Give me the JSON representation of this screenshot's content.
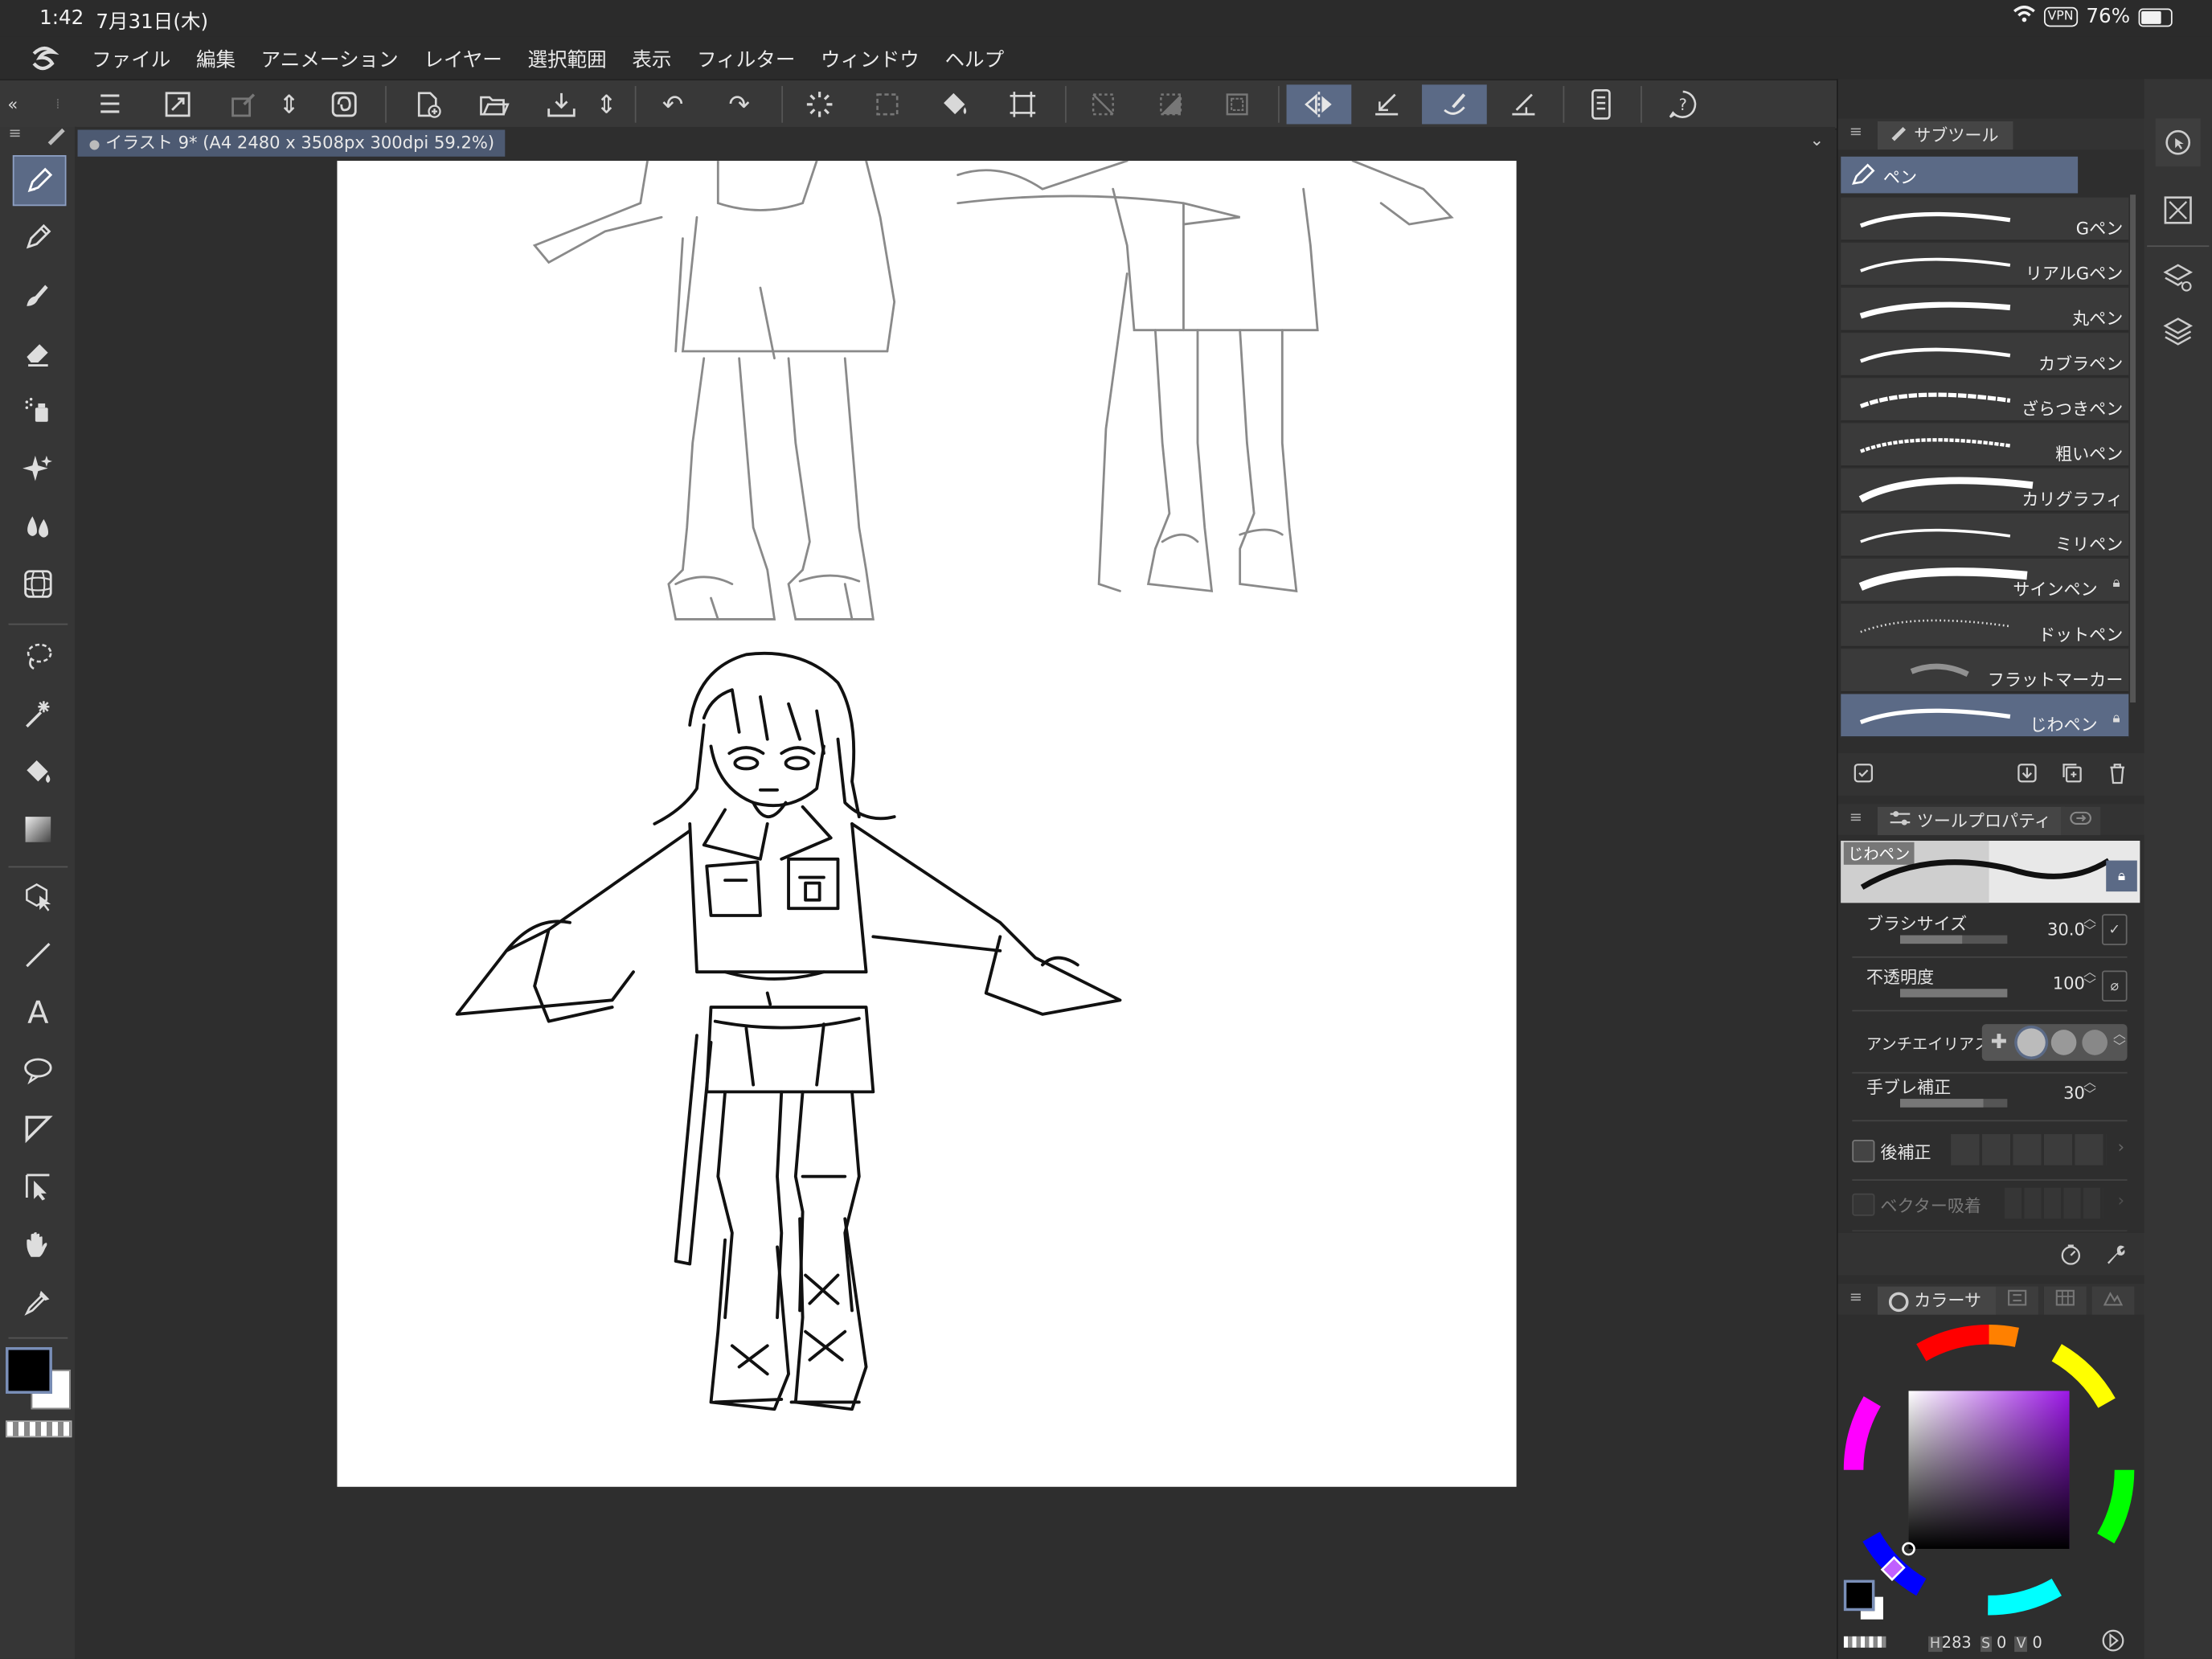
{
  "status": {
    "time": "1:42",
    "date": "7月31日(木)",
    "vpn": "VPN",
    "battery": "76%"
  },
  "menu": [
    "ファイル",
    "編集",
    "アニメーション",
    "レイヤー",
    "選択範囲",
    "表示",
    "フィルター",
    "ウィンドウ",
    "ヘルプ"
  ],
  "doc": {
    "tab_title": "イラスト 9* (A4 2480 x 3508px 300dpi 59.2%)"
  },
  "subtool": {
    "panel_title": "サブツール",
    "group": "ペン",
    "brushes": [
      "Gペン",
      "リアルGペン",
      "丸ペン",
      "カブラペン",
      "ざらつきペン",
      "粗いペン",
      "カリグラフィ",
      "ミリペン",
      "サインペン",
      "ドットペン",
      "フラットマーカー",
      "じわペン"
    ],
    "selected": "じわペン"
  },
  "toolprop": {
    "panel_title": "ツールプロパティ",
    "preview_label": "じわペン",
    "brush_size_label": "ブラシサイズ",
    "brush_size": "30.0",
    "opacity_label": "不透明度",
    "opacity": "100",
    "antialias_label": "アンチエイリアス",
    "stabilization_label": "手ブレ補正",
    "stabilization": "30",
    "post_correction_label": "後補正",
    "vector_snap_label": "ベクター吸着"
  },
  "color": {
    "panel_title": "カラーサ",
    "h_label": "H",
    "h": "283",
    "s_label": "S",
    "s": "0",
    "v_label": "V",
    "v": "0",
    "main": "#000000",
    "sub": "#ffffff",
    "accent": "#5b6a86"
  }
}
